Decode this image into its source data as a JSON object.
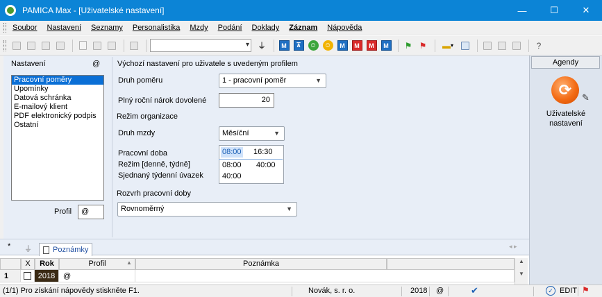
{
  "window": {
    "title": "PAMICA Max - [Uživatelské nastavení]",
    "minimize": "—",
    "maximize": "☐",
    "close": "✕"
  },
  "menu": {
    "items": [
      "Soubor",
      "Nastavení",
      "Seznamy",
      "Personalistika",
      "Mzdy",
      "Podání",
      "Doklady",
      "Záznam",
      "Nápověda"
    ]
  },
  "toolbar": {
    "combo_value": "",
    "icons": [
      "open-icon",
      "print-icon",
      "copy-icon",
      "new-doc-icon",
      "save-icon",
      "delete-icon",
      "filter-icon",
      "m-blue-icon",
      "tree-icon",
      "person-green-icon",
      "person-yellow-icon",
      "m-red-icon",
      "calendar-icon",
      "flag-green-icon",
      "flag-red-icon",
      "folder-icon",
      "grid-icon",
      "list-icon",
      "help-icon"
    ]
  },
  "left": {
    "section_title": "Nastavení",
    "at_symbol": "@",
    "list_items": [
      "Pracovní poměry",
      "Upomínky",
      "Datová schránka",
      "E-mailový klient",
      "PDF elektronický podpis",
      "Ostatní"
    ],
    "selected_index": 0,
    "profil_label": "Profil",
    "profil_value": "@"
  },
  "form": {
    "heading": "Výchozí nastavení pro uživatele s uvedeným profilem",
    "druh_pomeru_label": "Druh poměru",
    "druh_pomeru_value": "1 - pracovní poměr",
    "narok_label": "Plný roční nárok dovolené",
    "narok_value": "20",
    "rezim_label": "Režim organizace",
    "druh_mzdy_label": "Druh mzdy",
    "druh_mzdy_value": "Měsíční",
    "pracovni_doba_label": "Pracovní doba",
    "rezim_den_tyden_label": "Režim [denně, týdně]",
    "sjednany_label": "Sjednaný týdenní úvazek",
    "pracovni_doba_from": "08:00",
    "pracovni_doba_to": "16:30",
    "rezim_denne": "08:00",
    "rezim_tydne": "40:00",
    "sjednany_value": "40:00",
    "rozvrh_label": "Rozvrh pracovní doby",
    "rozvrh_value": "Rovnoměrný"
  },
  "agenda": {
    "header": "Agendy",
    "item_label_line1": "Uživatelské",
    "item_label_line2": "nastavení",
    "accent": "#f36b14"
  },
  "bottom": {
    "tab_star": "*",
    "tab_notes": "Poznámky",
    "columns": [
      "X",
      "Rok",
      "Profil",
      "Poznámka"
    ],
    "rows": [
      {
        "num": "1",
        "x": "",
        "rok": "2018",
        "profil": "@",
        "poznamka": ""
      }
    ]
  },
  "status": {
    "hint": "(1/1) Pro získání nápovědy stiskněte F1.",
    "company": "Novák, s. r. o.",
    "year": "2018",
    "at": "@",
    "mode": "EDIT"
  },
  "colors": {
    "titlebar": "#0c84d6",
    "selection": "#0a6fd6",
    "panel": "#e8eef7"
  }
}
